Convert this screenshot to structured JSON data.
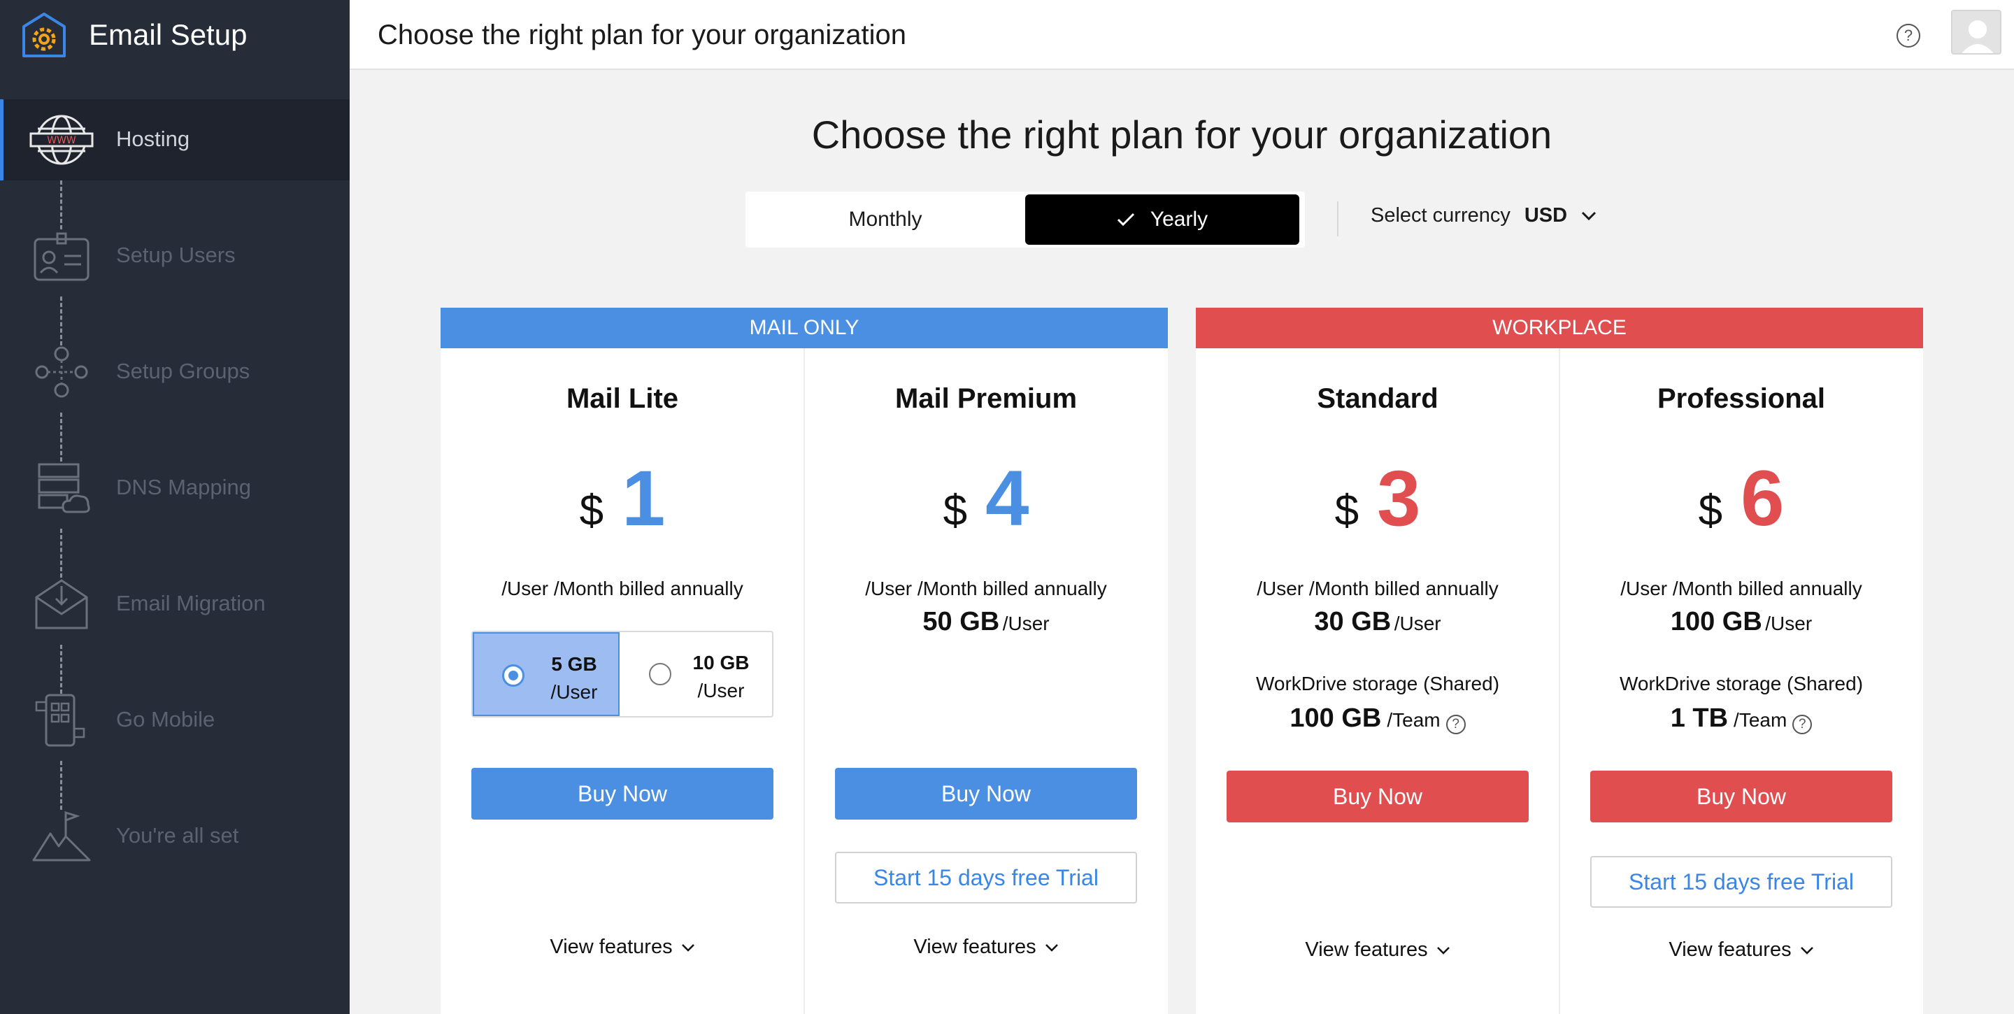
{
  "app": {
    "title": "Email Setup"
  },
  "sidebar": {
    "items": [
      {
        "label": "Hosting",
        "icon": "www-globe-icon",
        "active": true
      },
      {
        "label": "Setup Users",
        "icon": "id-card-icon",
        "active": false
      },
      {
        "label": "Setup Groups",
        "icon": "group-network-icon",
        "active": false
      },
      {
        "label": "DNS Mapping",
        "icon": "server-cloud-icon",
        "active": false
      },
      {
        "label": "Email Migration",
        "icon": "envelope-download-icon",
        "active": false
      },
      {
        "label": "Go Mobile",
        "icon": "mobile-apps-icon",
        "active": false
      },
      {
        "label": "You're all set",
        "icon": "mountain-flag-icon",
        "active": false
      }
    ]
  },
  "topbar": {
    "title": "Choose the right plan for your organization",
    "help": "?"
  },
  "main": {
    "heading": "Choose the right plan for your organization",
    "billing": {
      "monthly": "Monthly",
      "yearly": "Yearly",
      "selected": "Yearly"
    },
    "currency": {
      "label": "Select currency",
      "value": "USD"
    }
  },
  "groups": {
    "mail": {
      "label": "MAIL ONLY"
    },
    "work": {
      "label": "WORKPLACE"
    }
  },
  "plans": [
    {
      "name": "Mail Lite",
      "currency": "$",
      "price": "1",
      "billing": "/User /Month billed annually",
      "options": [
        {
          "size": "5 GB",
          "unit": "/User",
          "selected": true
        },
        {
          "size": "10 GB",
          "unit": "/User",
          "selected": false
        }
      ],
      "buy": "Buy Now",
      "features": "View features"
    },
    {
      "name": "Mail Premium",
      "currency": "$",
      "price": "4",
      "billing": "/User /Month billed annually",
      "storage": "50 GB",
      "storage_unit": "/User",
      "buy": "Buy Now",
      "trial": "Start 15 days free Trial",
      "features": "View features"
    },
    {
      "name": "Standard",
      "currency": "$",
      "price": "3",
      "billing": "/User /Month billed annually",
      "storage": "30 GB",
      "storage_unit": "/User",
      "workdrive_label": "WorkDrive storage (Shared)",
      "workdrive": "100 GB",
      "workdrive_unit": "/Team",
      "buy": "Buy Now",
      "features": "View features"
    },
    {
      "name": "Professional",
      "currency": "$",
      "price": "6",
      "billing": "/User /Month billed annually",
      "storage": "100 GB",
      "storage_unit": "/User",
      "workdrive_label": "WorkDrive storage (Shared)",
      "workdrive": "1 TB",
      "workdrive_unit": "/Team",
      "buy": "Buy Now",
      "trial": "Start 15 days free Trial",
      "features": "View features"
    }
  ],
  "colors": {
    "sidebar": "#262c38",
    "blue": "#4b8fe2",
    "red": "#e04e50",
    "trial_text": "#3a86e6"
  }
}
